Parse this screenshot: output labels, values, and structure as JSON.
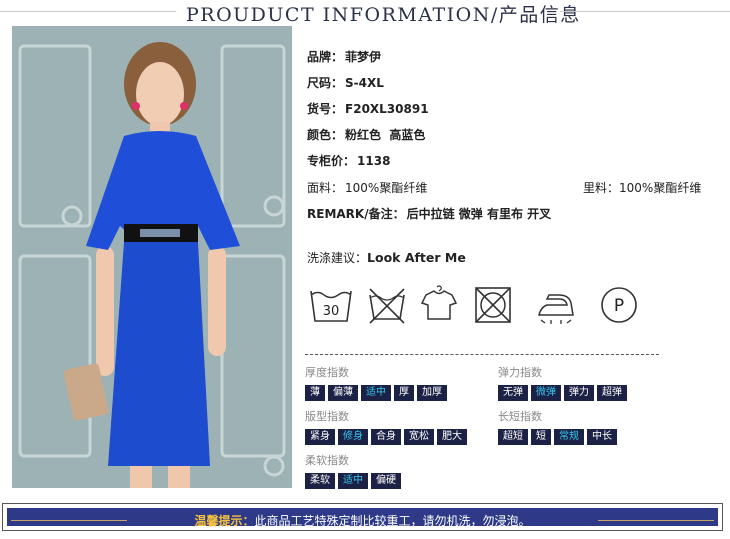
{
  "header": {
    "title": "PROUDUCT INFORMATION/产品信息"
  },
  "info": {
    "brand": {
      "label": "品牌：",
      "value": "菲梦伊"
    },
    "size": {
      "label": "尺码：",
      "value": "S-4XL"
    },
    "item_no": {
      "label": "货号：",
      "value": "F20XL30891"
    },
    "color": {
      "label": "颜色：",
      "value": "粉红色  高蓝色"
    },
    "price": {
      "label": "专柜价：",
      "value": "1138"
    },
    "fabric": {
      "label": "面料：",
      "value": "100%聚酯纤维"
    },
    "lining": {
      "label": "里料：",
      "value": "100%聚酯纤维"
    },
    "remark": {
      "label": "REMARK/备注：",
      "value": "后中拉链 微弹 有里布 开叉"
    },
    "wash": {
      "label": "洗涤建议：",
      "value": "Look After Me"
    }
  },
  "care_icons": [
    {
      "name": "wash-30-icon",
      "text": "30"
    },
    {
      "name": "no-bleach-icon",
      "text": ""
    },
    {
      "name": "hang-dry-icon",
      "text": ""
    },
    {
      "name": "no-tumble-dry-icon",
      "text": ""
    },
    {
      "name": "iron-icon",
      "text": ""
    },
    {
      "name": "dry-clean-p-icon",
      "text": "P"
    }
  ],
  "attributes": {
    "thickness": {
      "label": "厚度指数",
      "options": [
        "薄",
        "偏薄",
        "适中",
        "厚",
        "加厚"
      ],
      "selected": "适中"
    },
    "elasticity": {
      "label": "弹力指数",
      "options": [
        "无弹",
        "微弹",
        "弹力",
        "超弹"
      ],
      "selected": "微弹"
    },
    "fit": {
      "label": "版型指数",
      "options": [
        "紧身",
        "修身",
        "合身",
        "宽松",
        "肥大"
      ],
      "selected": "修身"
    },
    "length": {
      "label": "长短指数",
      "options": [
        "超短",
        "短",
        "常规",
        "中长"
      ],
      "selected": "常规"
    },
    "softness": {
      "label": "柔软指数",
      "options": [
        "柔软",
        "适中",
        "偏硬"
      ],
      "selected": "适中"
    }
  },
  "notice": {
    "highlight": "温馨提示：",
    "text": "此商品工艺特殊定制比较重工，请勿机洗，勿浸泡。"
  },
  "colors": {
    "navy": "#1c2245",
    "cyan": "#35c7ef",
    "banner": "#2e3a87",
    "gold": "#f6c03f",
    "dress": "#1f4fd8"
  }
}
